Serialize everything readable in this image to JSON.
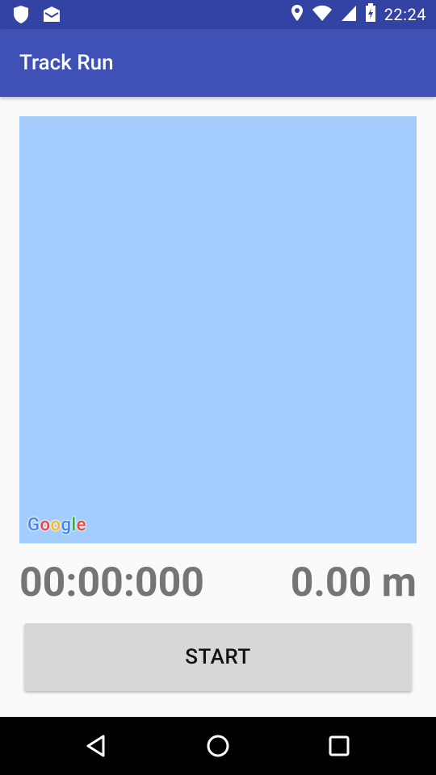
{
  "status_bar": {
    "time": "22:24",
    "icons": [
      "shield-icon",
      "mail-icon",
      "location-icon",
      "wifi-icon",
      "signal-icon",
      "battery-icon"
    ]
  },
  "app_bar": {
    "title": "Track Run"
  },
  "map": {
    "logo_text": "Google",
    "background_color": "#a4cdfd"
  },
  "stats": {
    "timer": "00:00:000",
    "distance": "0.00 m"
  },
  "controls": {
    "start_label": "START"
  },
  "nav_bar": {
    "icons": [
      "back-icon",
      "home-icon",
      "recents-icon"
    ]
  },
  "colors": {
    "primary": "#3f51b5",
    "primary_dark": "#3343a3",
    "button": "#d6d7d7",
    "stat_text": "#757575"
  }
}
